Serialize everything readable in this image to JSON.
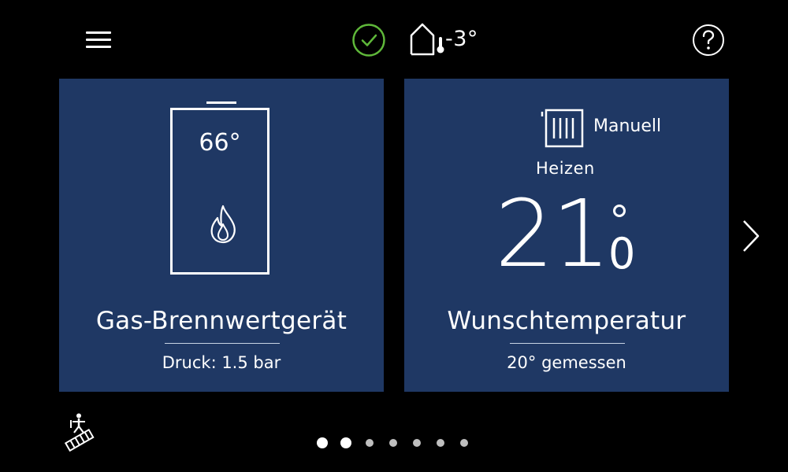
{
  "status": {
    "outside_temp": "-3°"
  },
  "boiler": {
    "temperature": "66°",
    "title": "Gas-Brennwertgerät",
    "pressure": "Druck: 1.5 bar"
  },
  "room": {
    "mode": "Manuell",
    "operation": "Heizen",
    "setpoint_integer": "21",
    "setpoint_decimal": "0",
    "title": "Wunschtemperatur",
    "measured": "20° gemessen"
  },
  "pager": {
    "total": 7,
    "active": [
      1,
      2
    ]
  },
  "colors": {
    "tile": "#1f3864",
    "status_ok": "#5fb83a",
    "background": "#000000"
  },
  "icons": [
    "menu-icon",
    "check-circle-icon",
    "house-thermometer-icon",
    "help-icon",
    "boiler-icon",
    "flame-icon",
    "radiator-icon",
    "chevron-right-icon",
    "chimney-sweep-icon"
  ]
}
